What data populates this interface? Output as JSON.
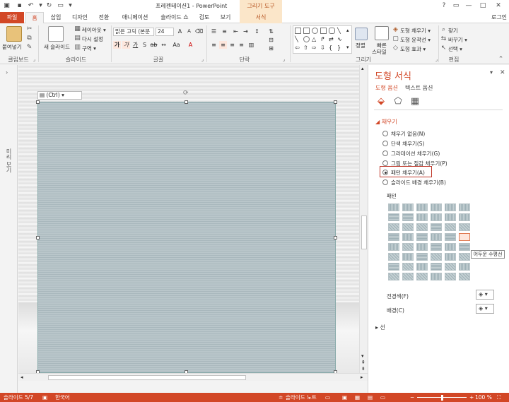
{
  "titlebar": {
    "doc_title": "프레젠테이션1 - PowerPoint",
    "context_title": "그리기 도구",
    "win_help": "?",
    "win_ribbon": "▭",
    "win_min": "—",
    "win_max": "□",
    "win_close": "✕"
  },
  "tabs": {
    "file": "파일",
    "home": "홈",
    "insert": "삽입",
    "design": "디자인",
    "transitions": "전환",
    "animations": "애니메이션",
    "slideshow": "슬라이드 쇼",
    "review": "검토",
    "view": "보기",
    "format": "서식",
    "login": "로그인"
  },
  "ribbon": {
    "clipboard": {
      "label": "클립보드",
      "paste": "붙여넣기"
    },
    "slides": {
      "label": "슬라이드",
      "new_slide": "새 슬라이드",
      "layout": "레이아웃 ▾",
      "reset": "다시 설정",
      "section": "구역 ▾"
    },
    "font": {
      "label": "글꼴",
      "font_name": "맑은 고딕 (본문",
      "font_size": "24"
    },
    "paragraph": {
      "label": "단락"
    },
    "drawing": {
      "label": "그리기",
      "arrange": "정렬",
      "quick_styles_line1": "빠른",
      "quick_styles_line2": "스타일",
      "shape_fill": "도형 채우기 ▾",
      "shape_outline": "도형 윤곽선 ▾",
      "shape_effects": "도형 효과 ▾"
    },
    "editing": {
      "label": "편집",
      "find": "찾기",
      "replace": "바꾸기 ▾",
      "select": "선택 ▾"
    }
  },
  "thumbpane": {
    "label": "미리 보기"
  },
  "editarea": {
    "paste_options": "(Ctrl) ▾"
  },
  "format_pane": {
    "title": "도형 서식",
    "tab_shape": "도형 옵션",
    "tab_text": "텍스트 옵션",
    "section_fill": "◢  채우기",
    "options": [
      {
        "label": "채우기 없음(N)",
        "selected": false
      },
      {
        "label": "단색 채우기(S)",
        "selected": false
      },
      {
        "label": "그라데이션 채우기(G)",
        "selected": false
      },
      {
        "label": "그림 또는 질감 채우기(P)",
        "selected": false
      },
      {
        "label": "패턴 채우기(A)",
        "selected": true
      },
      {
        "label": "슬라이드 배경 채우기(B)",
        "selected": false
      }
    ],
    "pattern_label": "패턴",
    "tooltip": "어두운 수평선",
    "foreground_label": "전경색(F)",
    "background_label": "배경(C)",
    "section_line": "▸  선"
  },
  "statusbar": {
    "slide_info": "슬라이드 5/7",
    "language": "한국어",
    "notes": "슬라이드 노트",
    "zoom": "100 %"
  }
}
